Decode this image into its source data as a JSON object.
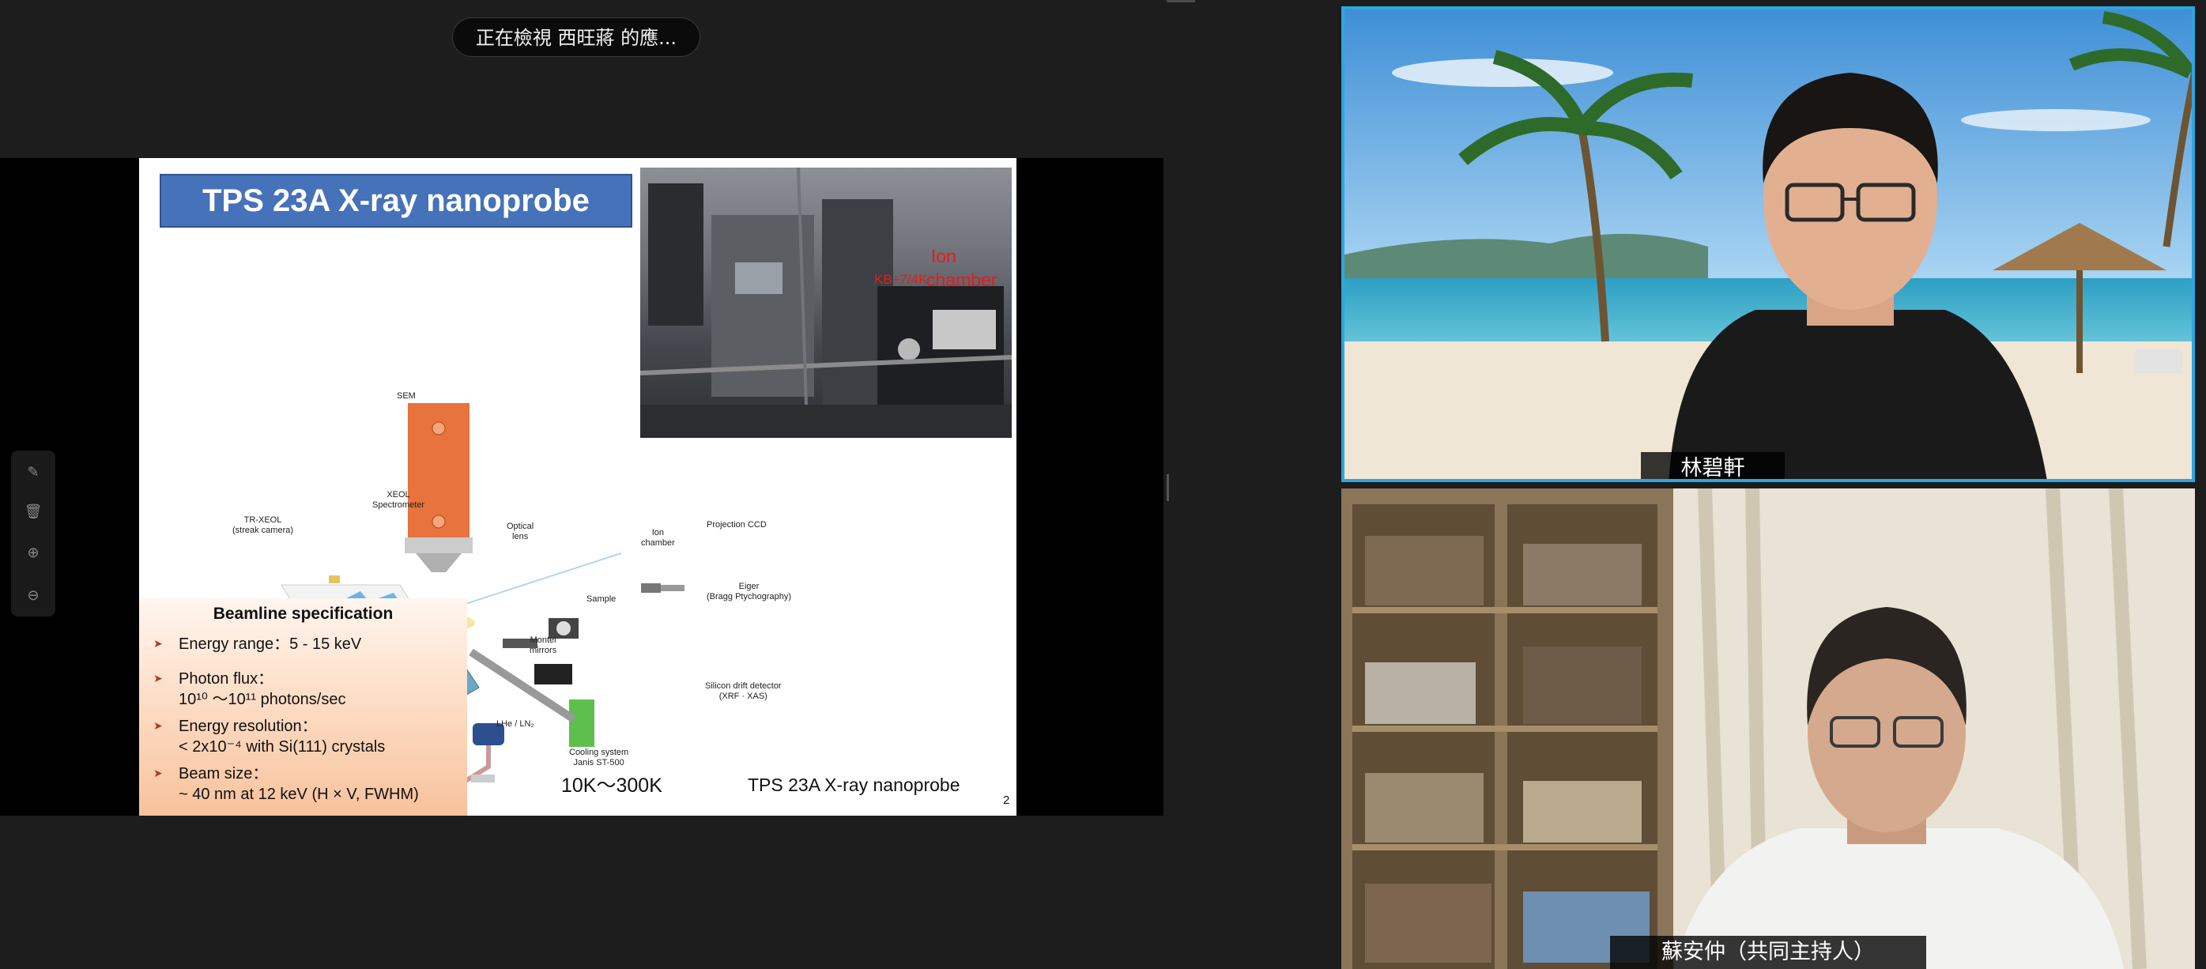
{
  "banner": {
    "viewing_text": "正在檢視 西旺蔣 的應..."
  },
  "slide": {
    "title": "TPS 23A X-ray nanoprobe",
    "photo_labels": {
      "ion": "Ion",
      "chamber": "chamber",
      "stage": "KB+7/4K"
    },
    "diagram_labels": {
      "sem": "SEM",
      "xeol_spectrometer": "XEOL\nSpectrometer",
      "tr_xeol": "TR-XEOL\n(streak camera)",
      "optical_lens": "Optical\nlens",
      "ion_chamber": "Ion\nchamber",
      "projection_ccd": "Projection CCD",
      "eiger": "Eiger\n(Bragg Ptychography)",
      "sample": "Sample",
      "montel_mirrors": "Montel\nmirrors",
      "silicon_detector": "Silicon drift detector\n(XRF · XAS)",
      "lhe_ln2": "LHe / LN₂",
      "cooling_system": "Cooling system\nJanis ST-500"
    },
    "spec": {
      "heading": "Beamline specification",
      "items": [
        {
          "label": "Energy range：5 - 15 keV",
          "sub": ""
        },
        {
          "label": "Photon flux：",
          "sub": "10¹⁰ ～10¹¹ photons/sec"
        },
        {
          "label": "Energy resolution：",
          "sub": "< 2x10⁻⁴ with Si(111) crystals"
        },
        {
          "label": "Beam size：",
          "sub": "~ 40 nm at 12 keV (H × V, FWHM)"
        }
      ]
    },
    "temp_range": "10K～300K",
    "caption": "TPS 23A X-ray nanoprobe",
    "page_number": "2"
  },
  "toolbar": {
    "icons": [
      "annotate-icon",
      "delete-icon",
      "zoom-in-icon",
      "zoom-out-icon"
    ]
  },
  "participants": [
    {
      "name": "林碧軒",
      "active_speaker": true
    },
    {
      "name": "蘇安仲（共同主持人）",
      "active_speaker": false
    }
  ],
  "colors": {
    "active_speaker_border": "#2da6e1",
    "slide_title_bg": "#4572b8"
  }
}
